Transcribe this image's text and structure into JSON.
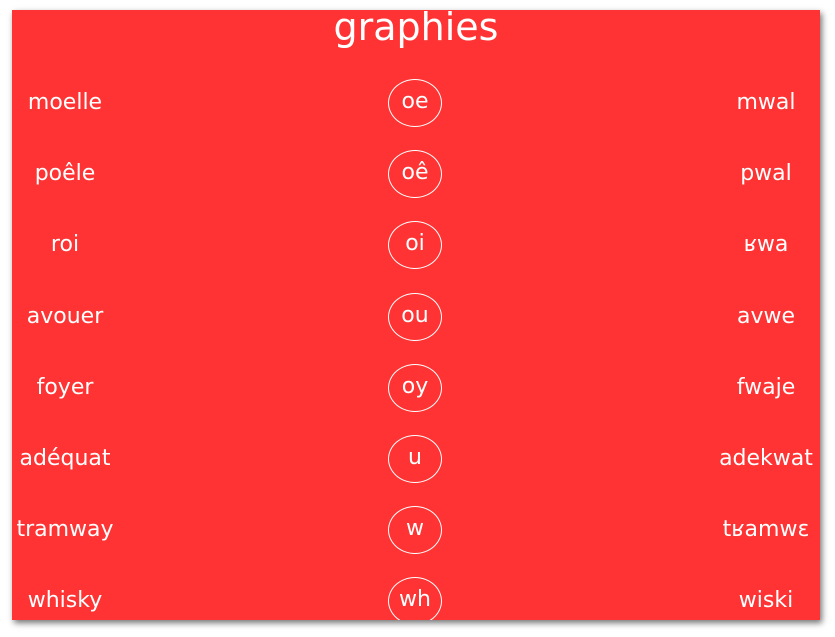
{
  "title": "graphies",
  "rows": [
    {
      "word": "moelle",
      "grapheme": "oe",
      "phonetic": "mwal"
    },
    {
      "word": "poêle",
      "grapheme": "oê",
      "phonetic": "pwal"
    },
    {
      "word": "roi",
      "grapheme": "oi",
      "phonetic": "ʁwa"
    },
    {
      "word": "avouer",
      "grapheme": "ou",
      "phonetic": "avwe"
    },
    {
      "word": "foyer",
      "grapheme": "oy",
      "phonetic": "fwaje"
    },
    {
      "word": "adéquat",
      "grapheme": "u",
      "phonetic": "adekwat"
    },
    {
      "word": "tramway",
      "grapheme": "w",
      "phonetic": "tʁamwɛ"
    },
    {
      "word": "whisky",
      "grapheme": "wh",
      "phonetic": "wiski"
    }
  ],
  "colors": {
    "background": "#ff3333",
    "text": "#ffffff"
  }
}
